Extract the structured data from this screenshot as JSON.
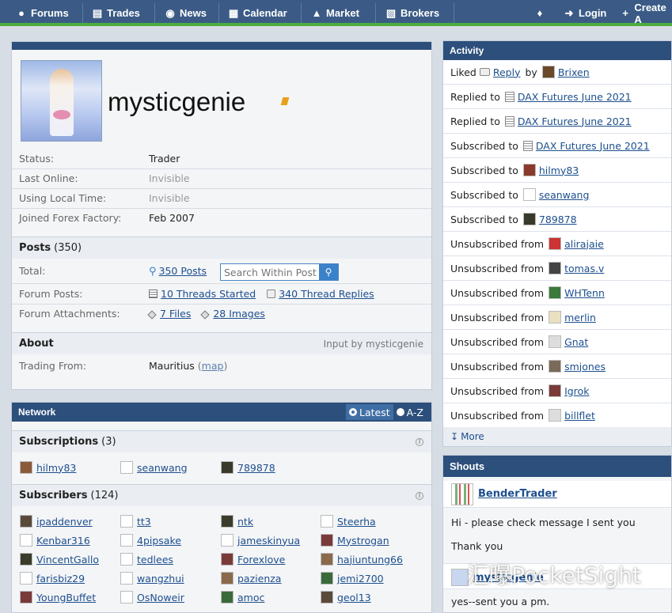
{
  "nav": {
    "items": [
      {
        "label": "Forums",
        "icon": "chat-bubbles-icon"
      },
      {
        "label": "Trades",
        "icon": "bar-chart-icon"
      },
      {
        "label": "News",
        "icon": "globe-icon"
      },
      {
        "label": "Calendar",
        "icon": "calendar-icon"
      },
      {
        "label": "Market",
        "icon": "market-chart-icon"
      },
      {
        "label": "Brokers",
        "icon": "brokers-icon"
      }
    ],
    "login": "Login",
    "create": "Create A"
  },
  "profile": {
    "username": "mysticgenie",
    "fields": [
      {
        "label": "Status:",
        "value": "Trader",
        "muted": false
      },
      {
        "label": "Last Online:",
        "value": "Invisible",
        "muted": true
      },
      {
        "label": "Using Local Time:",
        "value": "Invisible",
        "muted": true
      },
      {
        "label": "Joined Forex Factory:",
        "value": "Feb 2007",
        "muted": false
      }
    ],
    "posts": {
      "title": "Posts",
      "count": "(350)",
      "total_label": "Total:",
      "total_link": "350 Posts",
      "search_placeholder": "Search Within Post",
      "forum_posts_label": "Forum Posts:",
      "threads_started": "10 Threads Started",
      "thread_replies": "340 Thread Replies",
      "attachments_label": "Forum Attachments:",
      "files": "7 Files",
      "images": "28 Images"
    },
    "about": {
      "title": "About",
      "input_by": "Input by mysticgenie",
      "trading_from_label": "Trading From:",
      "trading_from": "Mauritius",
      "map_link": "map"
    }
  },
  "network": {
    "title": "Network",
    "sort_latest": "Latest",
    "sort_az": "A-Z",
    "subscriptions_title": "Subscriptions",
    "subscriptions_count": "(3)",
    "subscriptions": [
      "hilmy83",
      "seanwang",
      "789878"
    ],
    "subscribers_title": "Subscribers",
    "subscribers_count": "(124)",
    "subscribers": [
      [
        "ipaddenver",
        "tt3",
        "ntk",
        "Steerha"
      ],
      [
        "Kenbar316",
        "4pipsake",
        "jameskinyua",
        "Mystrogan"
      ],
      [
        "VincentGallo",
        "tedlees",
        "Forexlove",
        "hajiuntung66"
      ],
      [
        "farisbiz29",
        "wangzhui",
        "pazienza",
        "jemi2700"
      ],
      [
        "YoungBuffet",
        "OsNoweir",
        "amoc",
        "geol13"
      ]
    ]
  },
  "activity": {
    "title": "Activity",
    "rows": [
      {
        "verb": "Liked",
        "pre_icon": "bubble",
        "link1": "Reply",
        "mid": "by",
        "icon": "user",
        "target": "Brixen"
      },
      {
        "verb": "Replied to",
        "icon": "thread",
        "target": "DAX Futures June 2021"
      },
      {
        "verb": "Replied to",
        "icon": "thread",
        "target": "DAX Futures June 2021"
      },
      {
        "verb": "Subscribed to",
        "icon": "thread",
        "target": "DAX Futures June 2021"
      },
      {
        "verb": "Subscribed to",
        "icon": "user",
        "target": "hilmy83"
      },
      {
        "verb": "Subscribed to",
        "icon": "user",
        "target": "seanwang"
      },
      {
        "verb": "Subscribed to",
        "icon": "user",
        "target": "789878"
      },
      {
        "verb": "Unsubscribed from",
        "icon": "user",
        "target": "alirajaie"
      },
      {
        "verb": "Unsubscribed from",
        "icon": "user",
        "target": "tomas.v"
      },
      {
        "verb": "Unsubscribed from",
        "icon": "user",
        "target": "WHTenn"
      },
      {
        "verb": "Unsubscribed from",
        "icon": "user",
        "target": "merlin"
      },
      {
        "verb": "Unsubscribed from",
        "icon": "user",
        "target": "Gnat"
      },
      {
        "verb": "Unsubscribed from",
        "icon": "user",
        "target": "smjones"
      },
      {
        "verb": "Unsubscribed from",
        "icon": "user",
        "target": "Igrok"
      },
      {
        "verb": "Unsubscribed from",
        "icon": "user",
        "target": "billflet"
      }
    ],
    "more": "More"
  },
  "shouts": {
    "title": "Shouts",
    "user": "BenderTrader",
    "line1": "Hi - please check message I sent you",
    "line2": "Thank you",
    "reply_user": "mysticgenie",
    "reply": "yes--sent you a pm."
  },
  "watermark": "汇曝PocketSight",
  "colors": {
    "nav": "#3b5b86",
    "panel_head": "#2c4f7c",
    "accent_green": "#4cae3f",
    "link": "#1d4f8e"
  }
}
